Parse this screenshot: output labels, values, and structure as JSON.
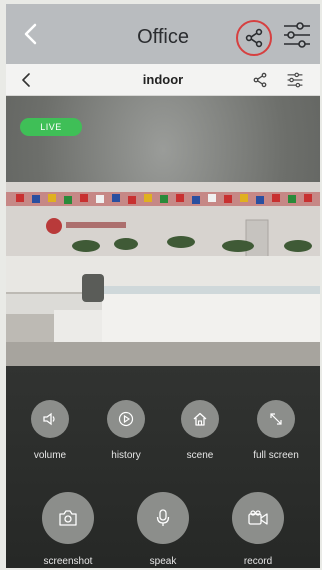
{
  "header": {
    "title": "Office",
    "icons": [
      "back-arrow-icon",
      "share-icon",
      "settings-sliders-icon"
    ]
  },
  "subheader": {
    "title": "indoor",
    "icons": [
      "back-arrow-icon",
      "share-icon",
      "settings-sliders-icon"
    ]
  },
  "video": {
    "status_label": "LIVE",
    "status_color": "#3fbf57"
  },
  "highlight_color": "#d64040",
  "controls": [
    {
      "label": "volume",
      "icon": "speaker-icon"
    },
    {
      "label": "history",
      "icon": "play-icon"
    },
    {
      "label": "scene",
      "icon": "home-icon"
    },
    {
      "label": "full screen",
      "icon": "expand-icon"
    },
    {
      "label": "screenshot",
      "icon": "camera-icon"
    },
    {
      "label": "speak",
      "icon": "microphone-icon"
    },
    {
      "label": "record",
      "icon": "video-camera-icon"
    }
  ]
}
